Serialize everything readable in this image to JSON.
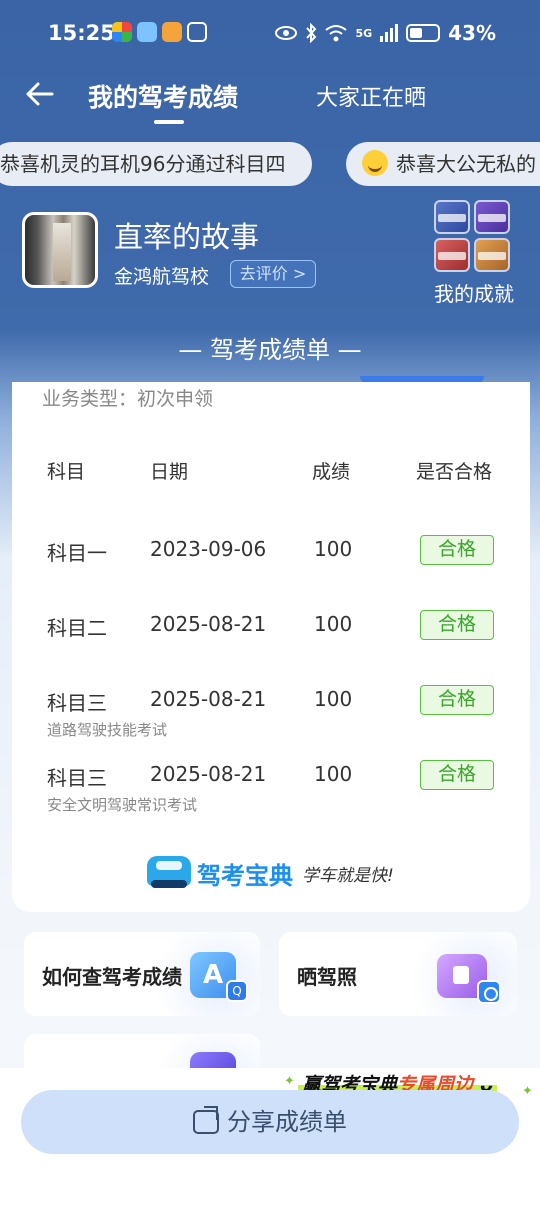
{
  "status_bar": {
    "time": "15:25",
    "network": "5G",
    "battery": "43%"
  },
  "nav": {
    "title": "我的驾考成绩",
    "tab_secondary": "大家正在晒"
  },
  "ticker": [
    {
      "text": "恭喜机灵的耳机96分通过科目四"
    },
    {
      "text": "恭喜大公无私的"
    }
  ],
  "profile": {
    "name": "直率的故事",
    "school": "金鸿航驾校",
    "review_label": "去评价 >"
  },
  "achievements": {
    "label": "我的成就"
  },
  "section_title": "— 驾考成绩单 —",
  "card": {
    "business_type": "业务类型：初次申领",
    "headers": {
      "subject": "科目",
      "date": "日期",
      "score": "成绩",
      "passed": "是否合格"
    },
    "rows": [
      {
        "subject": "科目一",
        "date": "2023-09-06",
        "score": "100",
        "status": "合格",
        "note": ""
      },
      {
        "subject": "科目二",
        "date": "2025-08-21",
        "score": "100",
        "status": "合格",
        "note": ""
      },
      {
        "subject": "科目三",
        "date": "2025-08-21",
        "score": "100",
        "status": "合格",
        "note": "道路驾驶技能考试"
      },
      {
        "subject": "科目三",
        "date": "2025-08-21",
        "score": "100",
        "status": "合格",
        "note": "安全文明驾驶常识考试"
      }
    ],
    "brand": {
      "name": "驾考宝典",
      "slogan": "学车就是快!"
    }
  },
  "tiles": [
    {
      "label": "如何查驾考成绩",
      "icon": "search-document-icon",
      "icon_letter": "A"
    },
    {
      "label": "晒驾照",
      "icon": "photo-icon"
    },
    {
      "label": "",
      "icon": "purple-app-icon"
    }
  ],
  "promo": {
    "prefix": "赢驾考宝典",
    "accent": "专属周边"
  },
  "share_button": {
    "label": "分享成绩单"
  },
  "colors": {
    "header_blue": "#3a64a6",
    "pass_green": "#3aa52a",
    "share_bg": "#cfe1fa",
    "brand_blue": "#1a8ff0"
  }
}
